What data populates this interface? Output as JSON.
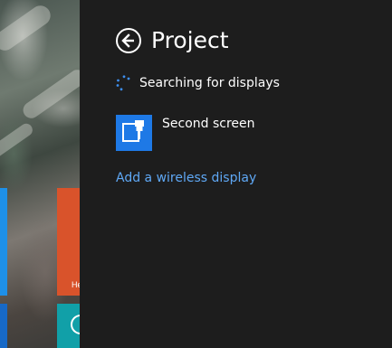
{
  "start_screen": {
    "tile_orange_label": "He"
  },
  "project_pane": {
    "title": "Project",
    "back_icon": "back-arrow-icon",
    "status": "Searching for displays",
    "displays": [
      {
        "label": "Second screen",
        "icon": "projector-icon"
      }
    ],
    "add_display_link": "Add a wireless display"
  },
  "colors": {
    "pane_background": "#1d1d1d",
    "accent_blue": "#1e79e6",
    "link": "#5fa8f5",
    "tile_orange": "#d9532b",
    "tile_teal": "#11a0a8"
  }
}
